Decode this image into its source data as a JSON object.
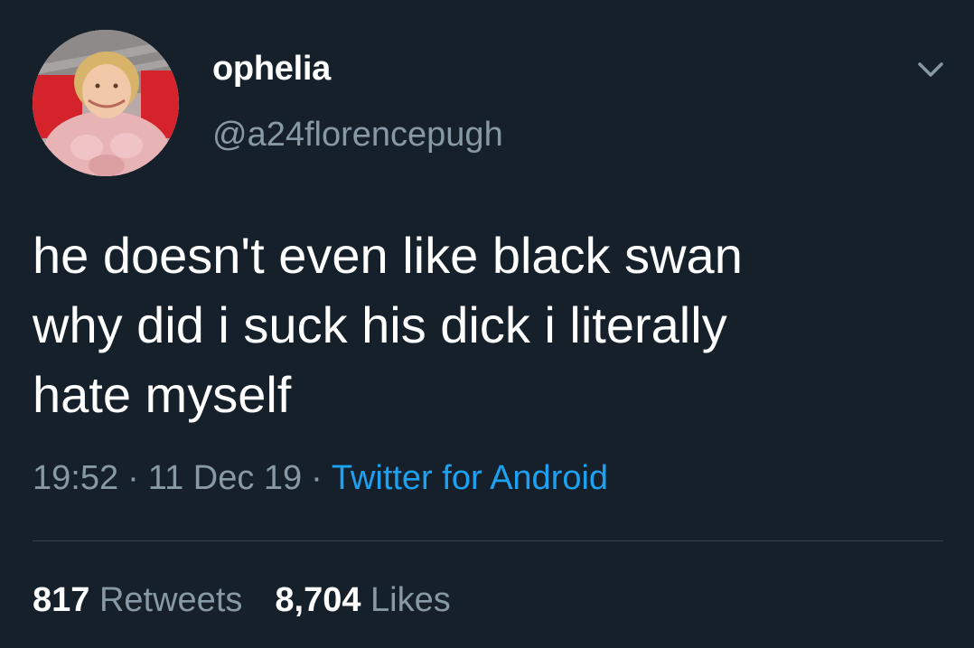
{
  "user": {
    "display_name": "ophelia",
    "handle": "@a24florencepugh",
    "avatar_icon": "profile-photo"
  },
  "header": {
    "menu_icon": "chevron-down-icon"
  },
  "tweet": {
    "lines": [
      "he doesn't even like black swan",
      "why did i suck his dick i literally",
      "hate myself"
    ]
  },
  "meta": {
    "time": "19:52",
    "separator": "·",
    "date": "11 Dec 19",
    "source": "Twitter for Android"
  },
  "stats": {
    "retweets_count": "817",
    "retweets_label": "Retweets",
    "likes_count": "8,704",
    "likes_label": "Likes"
  },
  "colors": {
    "background": "#15202b",
    "text_primary": "#ffffff",
    "text_secondary": "#8899a6",
    "link": "#1da1f2",
    "divider": "#38444d"
  }
}
